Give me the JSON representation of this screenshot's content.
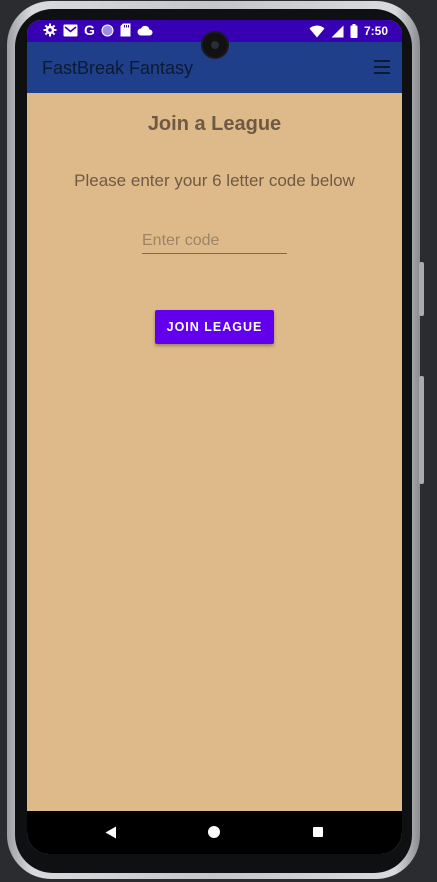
{
  "status_bar": {
    "time": "7:50",
    "left_icons": [
      "settings-icon",
      "gmail-icon",
      "google-icon",
      "circle-icon",
      "sd-card-icon",
      "cloud-icon"
    ],
    "right_icons": [
      "wifi-icon",
      "signal-icon",
      "battery-icon"
    ]
  },
  "app_bar": {
    "title": "FastBreak Fantasy",
    "menu_icon": "hamburger-menu-icon",
    "background_color": "#1f3f8a"
  },
  "page": {
    "title": "Join a League",
    "instructions": "Please enter your 6 letter code below",
    "code_input": {
      "value": "",
      "placeholder": "Enter code"
    },
    "join_button_label": "JOIN LEAGUE",
    "background_color": "#deba8a"
  },
  "nav_bar": {
    "back_icon": "back-triangle-icon",
    "home_icon": "home-circle-icon",
    "recents_icon": "recents-square-icon"
  },
  "colors": {
    "status_bar": "#3700b3",
    "accent": "#6200ee",
    "text_brown": "#6e5a44"
  }
}
